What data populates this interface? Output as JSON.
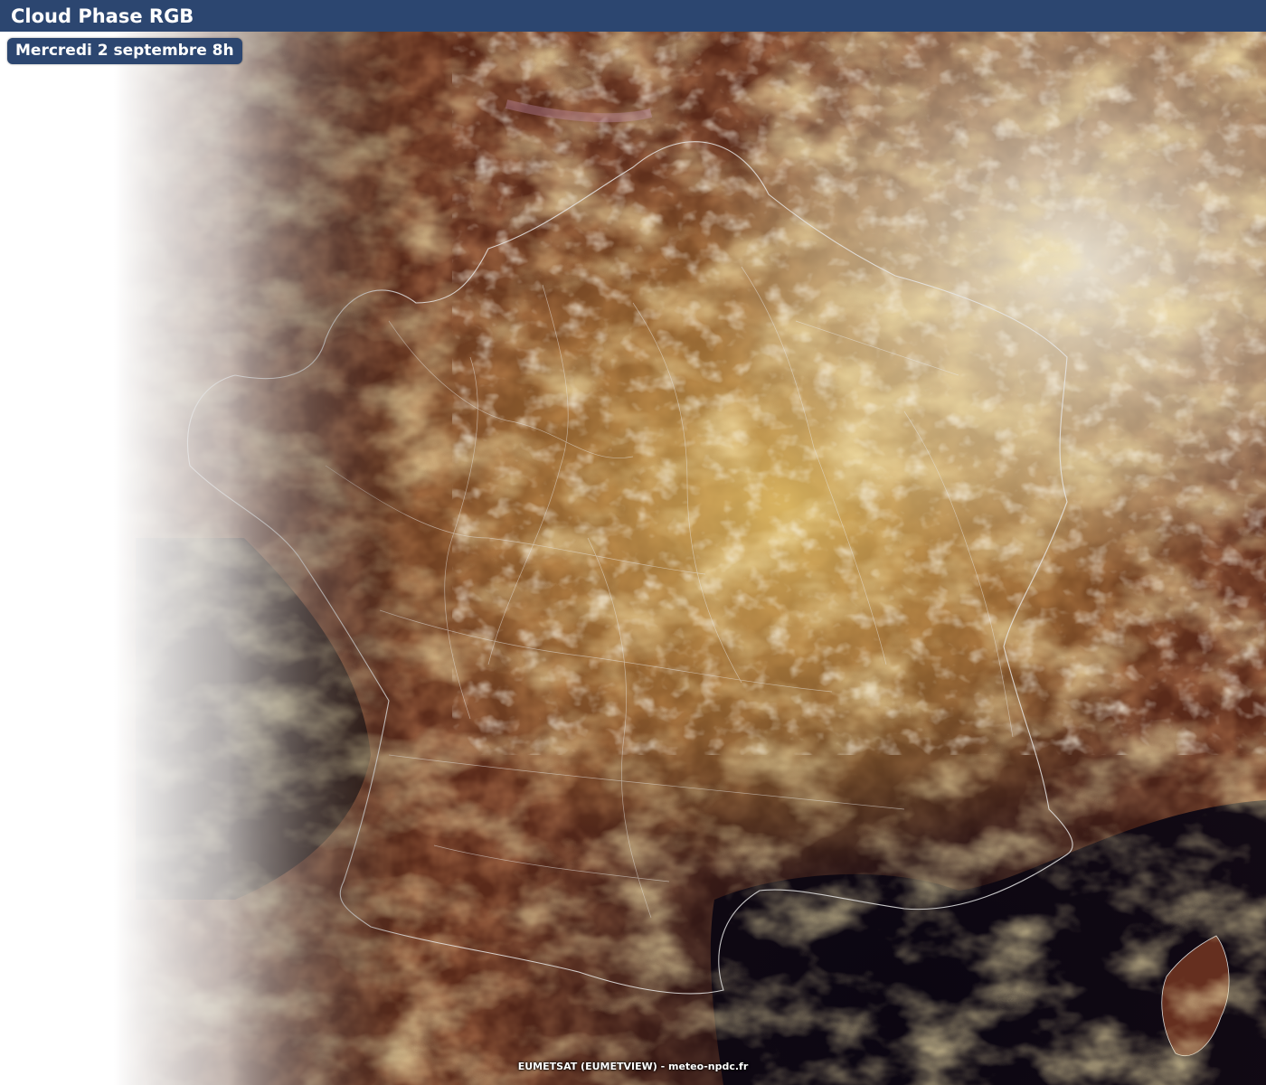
{
  "header": {
    "title": "Cloud Phase RGB"
  },
  "date_badge": {
    "label": "Mercredi 2 septembre 8h"
  },
  "footer": {
    "credit": "EUMETSAT (EUMETVIEW) - meteo-npdc.fr"
  },
  "colors": {
    "header_bg": "#2c4670",
    "ground": "#5a2a1a",
    "sea": "#120a14",
    "cloud_ice": "#e8e0c8",
    "cloud_water": "#d8b050",
    "night_terminator": "#ffffff"
  }
}
